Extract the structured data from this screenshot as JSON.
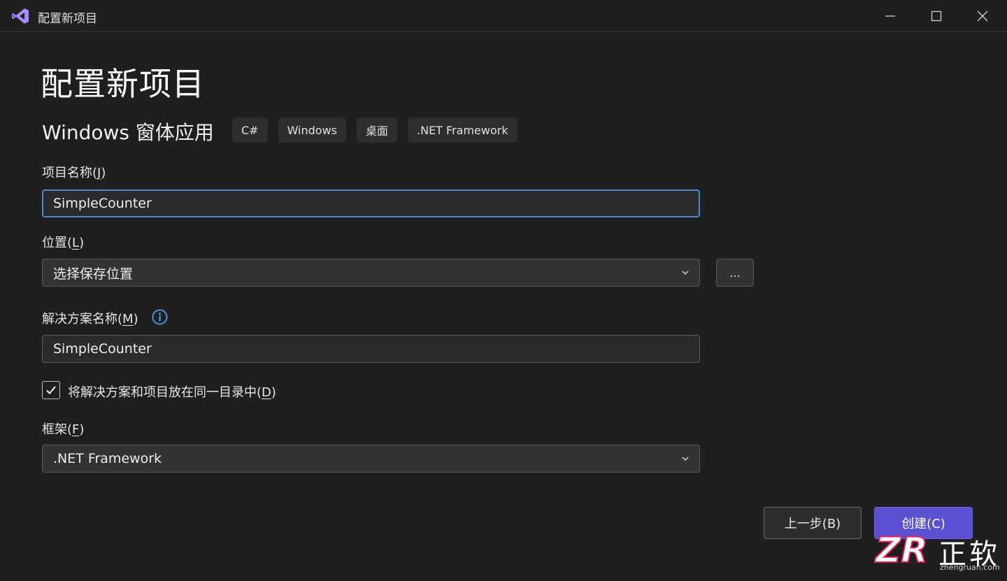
{
  "window": {
    "title": "配置新项目",
    "controls": {
      "minimize": "minimize-icon",
      "maximize": "maximize-icon",
      "close": "close-icon"
    }
  },
  "header": {
    "page_title": "配置新项目",
    "template_name": "Windows 窗体应用",
    "tags": [
      "C#",
      "Windows",
      "桌面",
      ".NET Framework"
    ]
  },
  "form": {
    "project_name": {
      "label_prefix": "项目名称(",
      "label_key": "J",
      "label_suffix": ")",
      "value": "SimpleCounter"
    },
    "location": {
      "label_prefix": "位置(",
      "label_key": "L",
      "label_suffix": ")",
      "value": "选择保存位置",
      "browse_label": "..."
    },
    "solution_name": {
      "label_prefix": "解决方案名称(",
      "label_key": "M",
      "label_suffix": ")",
      "value": "SimpleCounter"
    },
    "same_dir": {
      "checked": true,
      "label_prefix": "将解决方案和项目放在同一目录中(",
      "label_key": "D",
      "label_suffix": ")"
    },
    "framework": {
      "label_prefix": "框架(",
      "label_key": "F",
      "label_suffix": ")",
      "value": ".NET Framework"
    }
  },
  "footer": {
    "back_label": "上一步(B)",
    "create_label": "创建(C)"
  },
  "watermark": {
    "text": "正软",
    "site": "zhengruan.com"
  },
  "colors": {
    "accent": "#5b4fd2",
    "focus_border": "#4b8bd6",
    "info": "#4b9be8",
    "brand": "#e8205a"
  }
}
